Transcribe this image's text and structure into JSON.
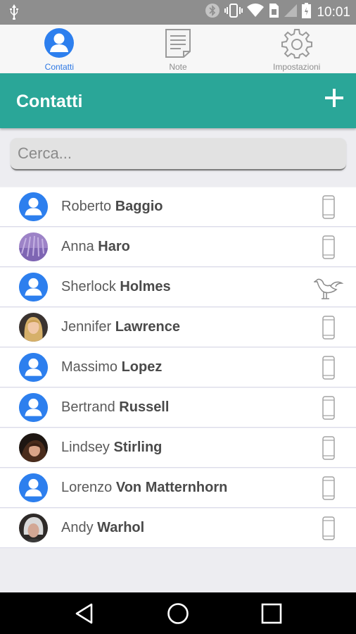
{
  "status_bar": {
    "time": "10:01",
    "icons": [
      "usb-icon",
      "bluetooth-icon",
      "vibrate-icon",
      "wifi-icon",
      "sim-icon",
      "signal-icon",
      "battery-icon"
    ]
  },
  "tabs": [
    {
      "label": "Contatti",
      "icon": "person-icon",
      "active": true
    },
    {
      "label": "Note",
      "icon": "note-icon",
      "active": false
    },
    {
      "label": "Impostazioni",
      "icon": "gear-icon",
      "active": false
    }
  ],
  "header": {
    "title": "Contatti",
    "add_icon": "plus-icon"
  },
  "search": {
    "placeholder": "Cerca...",
    "value": ""
  },
  "contacts": [
    {
      "first": "Roberto",
      "last": "Baggio",
      "avatar": "default",
      "device": "phone-icon"
    },
    {
      "first": "Anna",
      "last": "Haro",
      "avatar": "photo-lavender",
      "device": "phone-icon"
    },
    {
      "first": "Sherlock",
      "last": "Holmes",
      "avatar": "default",
      "device": "bird-icon"
    },
    {
      "first": "Jennifer",
      "last": "Lawrence",
      "avatar": "photo-blonde",
      "device": "phone-icon"
    },
    {
      "first": "Massimo",
      "last": "Lopez",
      "avatar": "default",
      "device": "phone-icon"
    },
    {
      "first": "Bertrand",
      "last": "Russell",
      "avatar": "default",
      "device": "phone-icon"
    },
    {
      "first": "Lindsey",
      "last": "Stirling",
      "avatar": "photo-dark",
      "device": "phone-icon"
    },
    {
      "first": "Lorenzo",
      "last": "Von Matternhorn",
      "avatar": "default",
      "device": "phone-icon"
    },
    {
      "first": "Andy",
      "last": "Warhol",
      "avatar": "photo-grey",
      "device": "phone-icon"
    }
  ],
  "nav": [
    "back-icon",
    "home-icon",
    "recents-icon"
  ],
  "colors": {
    "accent": "#2aa698",
    "active_tab": "#2d78e4",
    "avatar_default": "#2d7fee",
    "status_bar": "#8e8e8e"
  }
}
